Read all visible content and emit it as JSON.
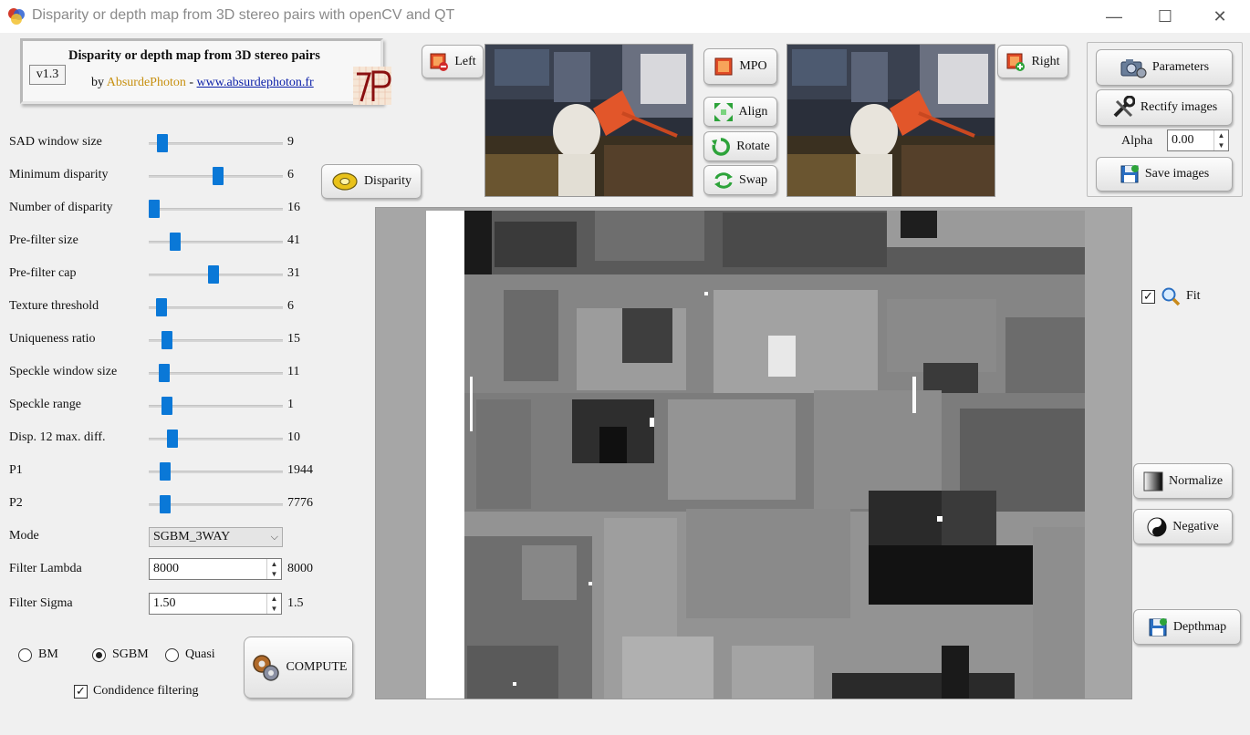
{
  "window": {
    "title": "Disparity or depth map from 3D stereo pairs with openCV and QT",
    "minimize": "—",
    "maximize": "☐",
    "close": "✕"
  },
  "about": {
    "heading": "Disparity or depth map from 3D stereo pairs",
    "version": "v1.3",
    "by": "by ",
    "author": "AbsurdePhoton",
    "separator": " - ",
    "site": "www.absurdephoton.fr",
    "logo_text": "AP"
  },
  "sliders": [
    {
      "label": "SAD window size",
      "value": "9",
      "level": 0.07
    },
    {
      "label": "Minimum disparity",
      "value": "6",
      "level": 0.52
    },
    {
      "label": "Number of disparity",
      "value": "16",
      "level": 0.0
    },
    {
      "label": "Pre-filter size",
      "value": "41",
      "level": 0.17
    },
    {
      "label": "Pre-filter cap",
      "value": "31",
      "level": 0.48
    },
    {
      "label": "Texture threshold",
      "value": "6",
      "level": 0.06
    },
    {
      "label": "Uniqueness ratio",
      "value": "15",
      "level": 0.1
    },
    {
      "label": "Speckle window size",
      "value": "11",
      "level": 0.08
    },
    {
      "label": "Speckle range",
      "value": "1",
      "level": 0.1
    },
    {
      "label": "Disp. 12 max. diff.",
      "value": "10",
      "level": 0.15
    },
    {
      "label": "P1",
      "value": "1944",
      "level": 0.09
    },
    {
      "label": "P2",
      "value": "7776",
      "level": 0.09
    }
  ],
  "mode": {
    "label": "Mode",
    "selected": "SGBM_3WAY"
  },
  "filter_lambda": {
    "label": "Filter Lambda",
    "input": "8000",
    "value": "8000"
  },
  "filter_sigma": {
    "label": "Filter Sigma",
    "input": "1.50",
    "value": "1.5"
  },
  "algorithms": {
    "bm": "BM",
    "sgbm": "SGBM",
    "quasi": "Quasi",
    "selected": "SGBM"
  },
  "confidence": {
    "label": "Condidence filtering",
    "checked": true,
    "mark": "✓"
  },
  "buttons": {
    "compute": "COMPUTE",
    "disparity": "Disparity",
    "left": "Left",
    "right": "Right",
    "mpo": "MPO",
    "align": "Align",
    "rotate": "Rotate",
    "swap": "Swap",
    "parameters": "Parameters",
    "rectify": "Rectify images",
    "save_images": "Save images",
    "normalize": "Normalize",
    "negative": "Negative",
    "depthmap": "Depthmap"
  },
  "alpha": {
    "label": "Alpha",
    "value": "0.00"
  },
  "fit": {
    "label": "Fit",
    "checked": true,
    "mark": "✓"
  },
  "colors": {
    "accent": "#0a78d7",
    "author": "#c79010",
    "link": "#0a1ea8"
  }
}
